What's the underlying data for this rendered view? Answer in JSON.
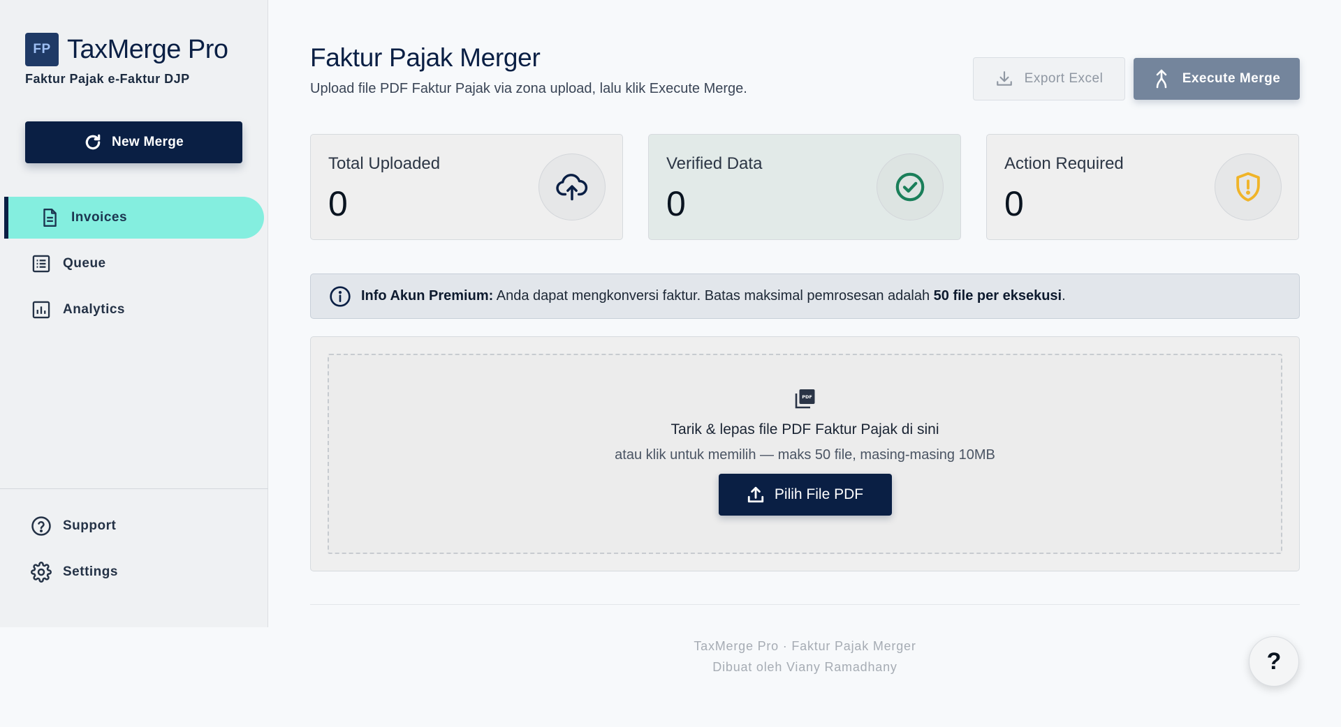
{
  "brand": {
    "logo_text": "FP",
    "title": "TaxMerge Pro",
    "subtitle": "Faktur Pajak e-Faktur DJP"
  },
  "sidebar": {
    "new_merge_label": "New Merge",
    "items": [
      {
        "label": "Invoices",
        "icon": "document-icon",
        "active": true
      },
      {
        "label": "Queue",
        "icon": "list-icon",
        "active": false
      },
      {
        "label": "Analytics",
        "icon": "chart-icon",
        "active": false
      }
    ],
    "bottom_items": [
      {
        "label": "Support",
        "icon": "help-circle-icon"
      },
      {
        "label": "Settings",
        "icon": "gear-icon"
      }
    ]
  },
  "header": {
    "title": "Faktur Pajak Merger",
    "subtitle": "Upload file PDF Faktur Pajak via zona upload, lalu klik Execute Merge.",
    "export_label": "Export Excel",
    "execute_label": "Execute Merge"
  },
  "stats": [
    {
      "label": "Total Uploaded",
      "value": "0",
      "icon": "cloud-upload-icon"
    },
    {
      "label": "Verified Data",
      "value": "0",
      "icon": "check-circle-icon"
    },
    {
      "label": "Action Required",
      "value": "0",
      "icon": "shield-alert-icon"
    }
  ],
  "info": {
    "bold_prefix": "Info Akun Premium:",
    "text": " Anda dapat mengkonversi faktur. Batas maksimal pemrosesan adalah ",
    "bold_limit": "50 file per eksekusi",
    "suffix": "."
  },
  "upload": {
    "title": "Tarik & lepas file PDF Faktur Pajak di sini",
    "subtitle": "atau klik untuk memilih — maks 50 file, masing-masing 10MB",
    "button_label": "Pilih File PDF",
    "icon": "pdf-files-icon"
  },
  "footer": {
    "line1": "TaxMerge Pro · Faktur Pajak Merger",
    "line2": "Dibuat oleh Viany Ramadhany"
  },
  "help_fab": "?",
  "colors": {
    "primary": "#0a1f44",
    "active_nav": "#84eedf",
    "success": "#1a7f5a",
    "warning": "#f0b429",
    "execute_disabled": "#74859c"
  }
}
